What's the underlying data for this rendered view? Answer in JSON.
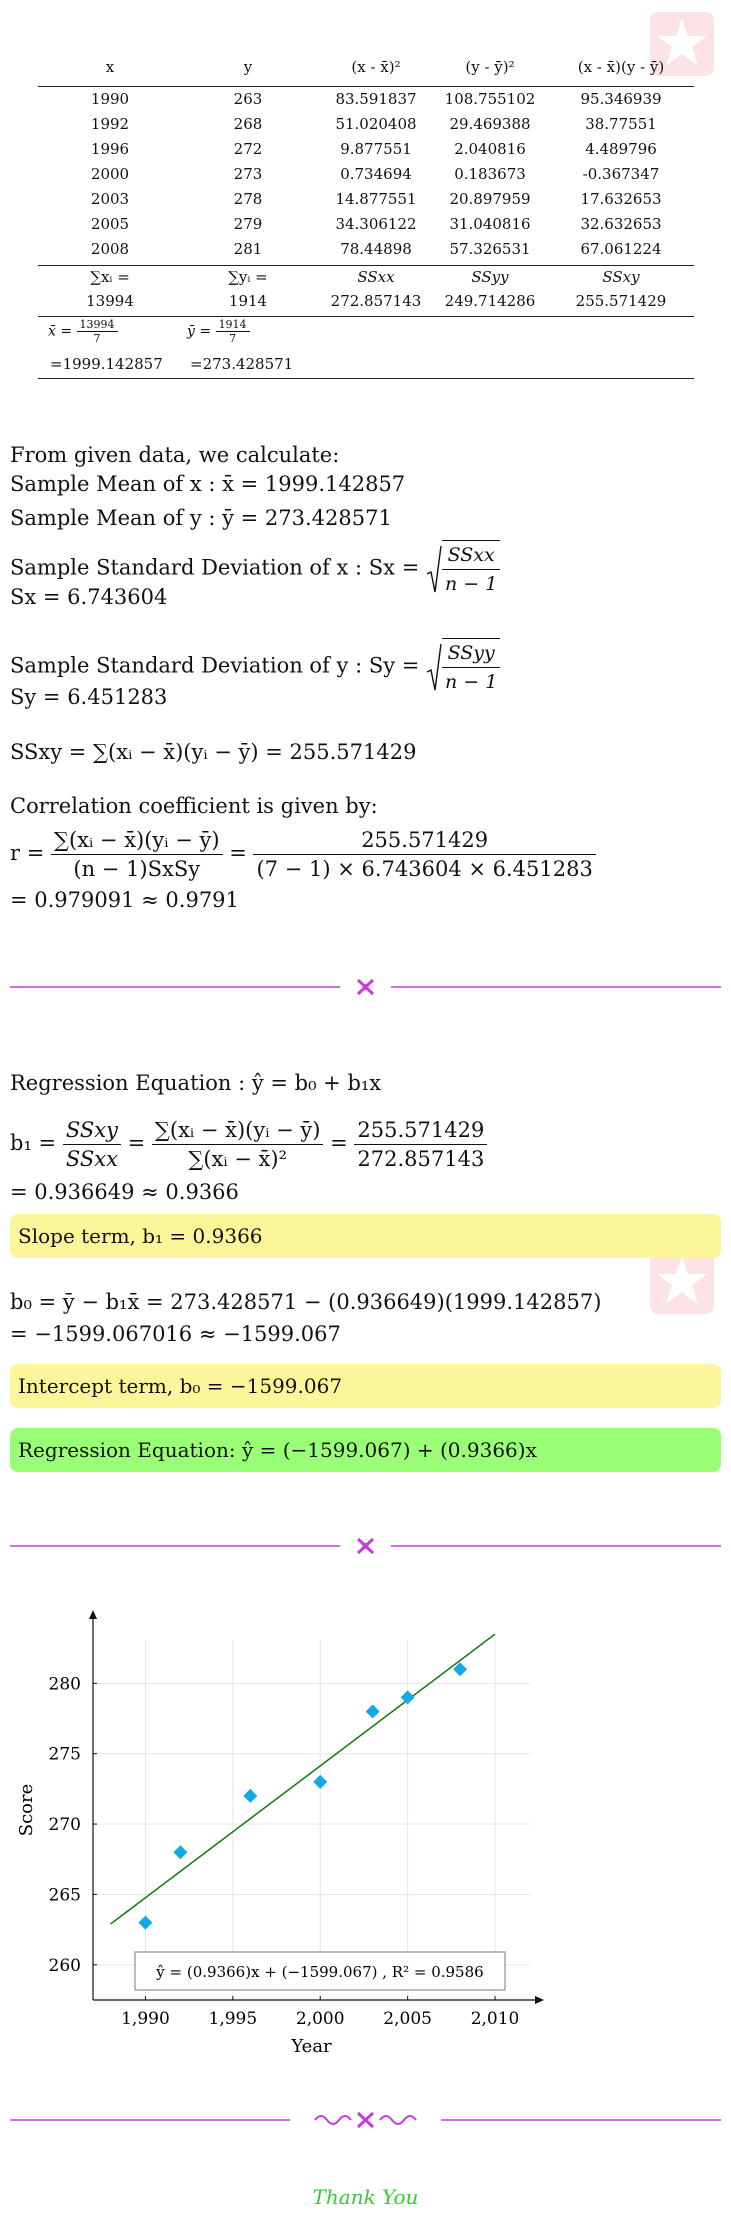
{
  "table": {
    "headers": [
      "x",
      "y",
      "(x - x̄)²",
      "(y - ȳ)²",
      "(x - x̄)(y - ȳ)"
    ],
    "rows": [
      [
        "1990",
        "263",
        "83.591837",
        "108.755102",
        "95.346939"
      ],
      [
        "1992",
        "268",
        "51.020408",
        "29.469388",
        "38.77551"
      ],
      [
        "1996",
        "272",
        "9.877551",
        "2.040816",
        "4.489796"
      ],
      [
        "2000",
        "273",
        "0.734694",
        "0.183673",
        "-0.367347"
      ],
      [
        "2003",
        "278",
        "14.877551",
        "20.897959",
        "17.632653"
      ],
      [
        "2005",
        "279",
        "34.306122",
        "31.040816",
        "32.632653"
      ],
      [
        "2008",
        "281",
        "78.44898",
        "57.326531",
        "67.061224"
      ]
    ],
    "sum_labels": [
      "∑xᵢ =",
      "∑yᵢ =",
      "SSxx",
      "SSyy",
      "SSxy"
    ],
    "sum_values": [
      "13994",
      "1914",
      "272.857143",
      "249.714286",
      "255.571429"
    ],
    "mean_x_num": "13994",
    "mean_x_den": "7",
    "mean_y_num": "1914",
    "mean_y_den": "7",
    "mean_x_value": "=1999.142857",
    "mean_y_value": "=273.428571"
  },
  "calc": {
    "intro": "From given data, we calculate:",
    "mean_x": "Sample Mean of x : x̄ = 1999.142857",
    "mean_y": "Sample Mean of y : ȳ = 273.428571",
    "sd_x_label": "Sample Standard Deviation of x : Sx =",
    "sd_x_num": "SSxx",
    "sd_x_den": "n − 1",
    "sd_x_value": "Sx = 6.743604",
    "sd_y_label": "Sample Standard Deviation of y : Sy =",
    "sd_y_num": "SSyy",
    "sd_y_den": "n − 1",
    "sd_y_value": "Sy = 6.451283",
    "ssxy": "SSxy = ∑(xᵢ − x̄)(yᵢ − ȳ) = 255.571429",
    "corr_intro": "Correlation coefficient is given by:",
    "r_lhs": "r =",
    "r_num": "∑(xᵢ − x̄)(yᵢ − ȳ)",
    "r_den": "(n − 1)SxSy",
    "r_num2": "255.571429",
    "r_den2": "(7 − 1) × 6.743604 × 6.451283",
    "r_value": "= 0.979091 ≈ 0.9791"
  },
  "regression": {
    "equation_form": "Regression Equation : ŷ = b₀ + b₁x",
    "b1_lhs": "b₁ =",
    "b1_n1": "SSxy",
    "b1_d1": "SSxx",
    "b1_n2": "∑(xᵢ − x̄)(yᵢ − ȳ)",
    "b1_d2": "∑(xᵢ − x̄)²",
    "b1_n3": "255.571429",
    "b1_d3": "272.857143",
    "b1_value": "= 0.936649 ≈ 0.9366",
    "slope_box": "Slope term, b₁ = 0.9366",
    "b0_line": "b₀ = ȳ − b₁x̄ = 273.428571 − (0.936649)(1999.142857)",
    "b0_value": "= −1599.067016 ≈ −1599.067",
    "intercept_box": "Intercept term, b₀ = −1599.067",
    "equation_box": "Regression Equation: ŷ = (−1599.067) + (0.9366)x"
  },
  "colors": {
    "divider": "#c43fd8",
    "yellow_box": "#fdf59a",
    "green_box": "#99ff77",
    "points": "#12a9e6",
    "fit_line": "#0d7a0d",
    "thank_you": "#33cc33"
  },
  "chart_data": {
    "type": "scatter",
    "x": [
      1990,
      1992,
      1996,
      2000,
      2003,
      2005,
      2008
    ],
    "y": [
      263,
      268,
      272,
      273,
      278,
      279,
      281
    ],
    "xlabel": "Year",
    "ylabel": "Score",
    "xlim": [
      1987,
      2012
    ],
    "ylim": [
      257.5,
      284.5
    ],
    "xticks": [
      "1,990",
      "1,995",
      "2,000",
      "2,005",
      "2,010"
    ],
    "xtick_values": [
      1990,
      1995,
      2000,
      2005,
      2010
    ],
    "yticks": [
      260,
      265,
      270,
      275,
      280
    ],
    "trendline": {
      "slope": 0.9366,
      "intercept": -1599.067,
      "x_start": 1988,
      "x_end": 2010
    },
    "legend": "ŷ = (0.9366)x + (−1599.067) , R² = 0.9586",
    "legend_position": "bottom",
    "grid": true
  },
  "footer": {
    "thank_you": "Thank You"
  }
}
